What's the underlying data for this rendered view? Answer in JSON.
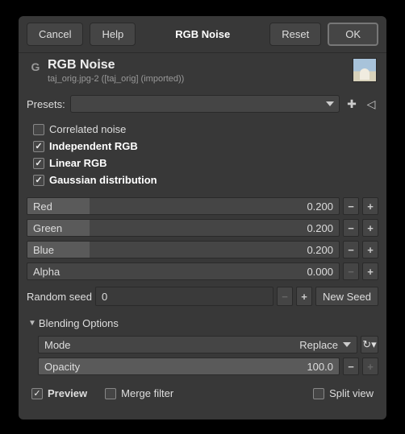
{
  "buttons": {
    "cancel": "Cancel",
    "help": "Help",
    "title": "RGB Noise",
    "reset": "Reset",
    "ok": "OK"
  },
  "header": {
    "title": "RGB Noise",
    "subtitle": "taj_orig.jpg-2 ([taj_orig] (imported))"
  },
  "presets_label": "Presets:",
  "checks": {
    "correlated": {
      "label": "Correlated noise",
      "checked": false
    },
    "independent": {
      "label": "Independent RGB",
      "checked": true
    },
    "linear": {
      "label": "Linear RGB",
      "checked": true
    },
    "gaussian": {
      "label": "Gaussian distribution",
      "checked": true
    }
  },
  "channels": {
    "red": {
      "label": "Red",
      "value": "0.200",
      "fill": 20
    },
    "green": {
      "label": "Green",
      "value": "0.200",
      "fill": 20
    },
    "blue": {
      "label": "Blue",
      "value": "0.200",
      "fill": 20
    },
    "alpha": {
      "label": "Alpha",
      "value": "0.000",
      "fill": 0
    }
  },
  "seed": {
    "label": "Random seed",
    "value": "0",
    "newseed": "New Seed"
  },
  "blending": {
    "header": "Blending Options",
    "mode_label": "Mode",
    "mode_value": "Replace",
    "opacity_label": "Opacity",
    "opacity_value": "100.0"
  },
  "footer": {
    "preview": {
      "label": "Preview",
      "checked": true
    },
    "merge": {
      "label": "Merge filter",
      "checked": false
    },
    "split": {
      "label": "Split view",
      "checked": false
    }
  }
}
